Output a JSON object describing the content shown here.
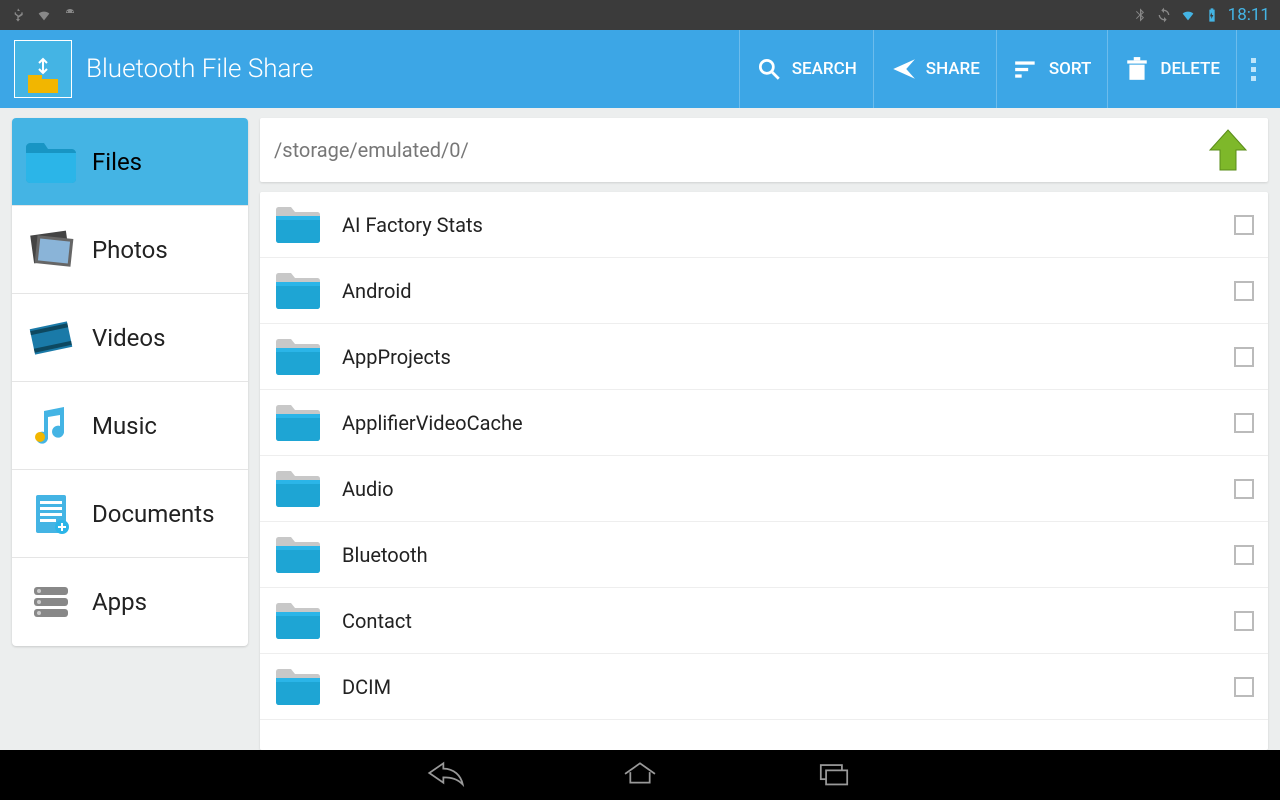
{
  "status": {
    "time": "18:11"
  },
  "header": {
    "title": "Bluetooth File Share",
    "actions": {
      "search": "SEARCH",
      "share": "SHARE",
      "sort": "SORT",
      "delete": "DELETE"
    }
  },
  "sidebar": {
    "items": [
      {
        "label": "Files",
        "active": true
      },
      {
        "label": "Photos",
        "active": false
      },
      {
        "label": "Videos",
        "active": false
      },
      {
        "label": "Music",
        "active": false
      },
      {
        "label": "Documents",
        "active": false
      },
      {
        "label": "Apps",
        "active": false
      }
    ]
  },
  "path": "/storage/emulated/0/",
  "files": [
    {
      "name": "AI Factory Stats"
    },
    {
      "name": "Android"
    },
    {
      "name": "AppProjects"
    },
    {
      "name": "ApplifierVideoCache"
    },
    {
      "name": "Audio"
    },
    {
      "name": "Bluetooth"
    },
    {
      "name": "Contact"
    },
    {
      "name": "DCIM"
    }
  ]
}
